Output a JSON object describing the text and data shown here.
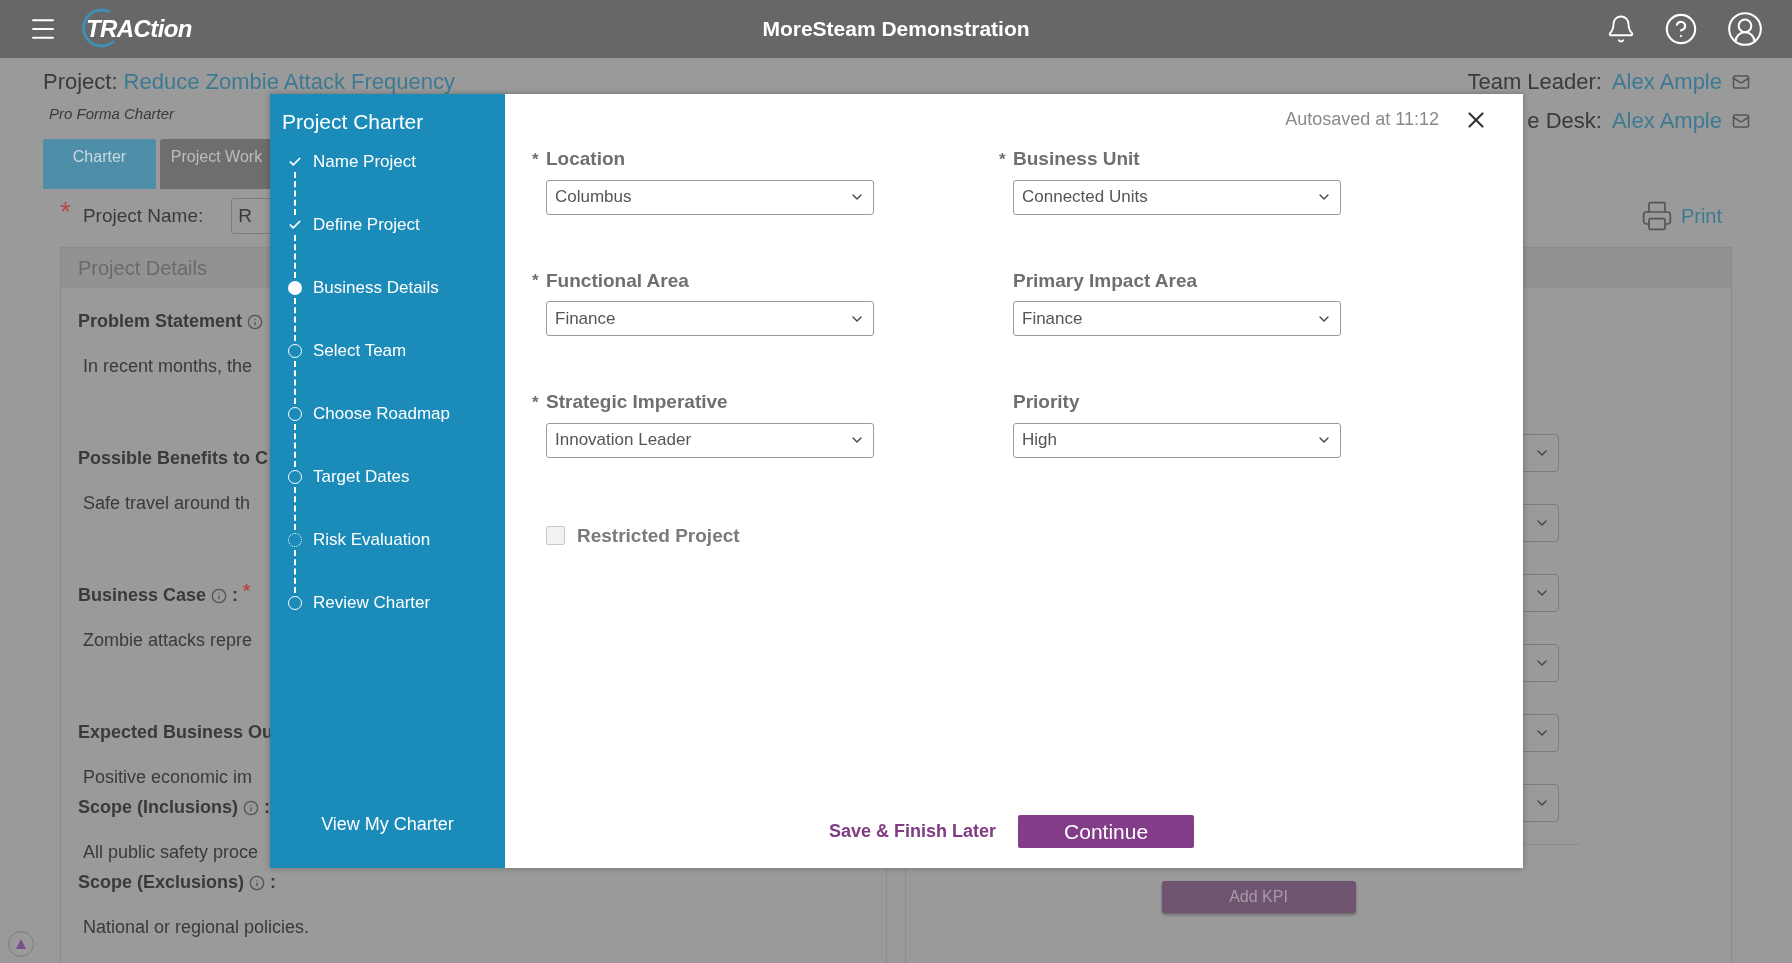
{
  "top_bar": {
    "logo": "TRACtion",
    "title": "MoreSteam Demonstration"
  },
  "project": {
    "label": "Project:",
    "name": "Reduce Zombie Attack Frequency",
    "subtitle": "Pro Forma Charter"
  },
  "people": [
    {
      "label": "Team Leader:",
      "name": "Alex Ample"
    },
    {
      "label": "e Desk:",
      "name": "Alex Ample"
    }
  ],
  "tabs": [
    {
      "label": "Charter",
      "selected": true
    },
    {
      "label": "Project Work",
      "selected": false
    }
  ],
  "project_name": {
    "required_mark": "*",
    "label": "Project Name:",
    "value": "R"
  },
  "print": "Print",
  "details": {
    "title": "Project Details",
    "sections": [
      {
        "title": "Problem Statement",
        "info": true,
        "text": "In recent months, the",
        "kind": "long"
      },
      {
        "title": "Possible Benefits to C",
        "info": false,
        "text": "Safe travel around th",
        "kind": "long"
      },
      {
        "title": "Business Case",
        "info": true,
        "colon": ":",
        "required_mark": "*",
        "text": "Zombie attacks repre",
        "kind": "long"
      },
      {
        "title": "Expected Business Ou",
        "info": false,
        "text": "Positive economic im",
        "kind": "short"
      },
      {
        "title": "Scope (Inclusions)",
        "info": true,
        "colon": ":",
        "text": "All public safety proce",
        "kind": "short"
      },
      {
        "title": "Scope (Exclusions)",
        "info": true,
        "colon": ":",
        "text": "National or regional policies.",
        "kind": "short"
      }
    ]
  },
  "kpi_panel": {
    "selects": [
      {
        "kind": "select"
      },
      {
        "kind": "select"
      },
      {
        "kind": "select"
      },
      {
        "kind": "select"
      },
      {
        "kind": "select"
      },
      {
        "kind": "select"
      }
    ],
    "button": "Add KPI"
  },
  "modal": {
    "title": "Project Charter",
    "steps": [
      {
        "label": "Name Project",
        "kind": "done"
      },
      {
        "label": "Define Project",
        "kind": "done"
      },
      {
        "label": "Business Details",
        "kind": "current"
      },
      {
        "label": "Select Team",
        "kind": "todo"
      },
      {
        "label": "Choose Roadmap",
        "kind": "todo"
      },
      {
        "label": "Target Dates",
        "kind": "todo"
      },
      {
        "label": "Risk Evaluation",
        "kind": "partial"
      },
      {
        "label": "Review Charter",
        "kind": "todo"
      }
    ],
    "view_link": "View My Charter",
    "autosave": "Autosaved at 11:12",
    "fields": [
      {
        "required_mark": "*",
        "label": "Location",
        "value": "Columbus"
      },
      {
        "required_mark": "*",
        "label": "Business Unit",
        "value": "Connected Units"
      },
      {
        "required_mark": "*",
        "label": "Functional Area",
        "value": "Finance"
      },
      {
        "label": "Primary Impact Area",
        "value": "Finance"
      },
      {
        "required_mark": "*",
        "label": "Strategic Imperative",
        "value": "Innovation Leader"
      },
      {
        "label": "Priority",
        "value": "High"
      }
    ],
    "restricted": {
      "label": "Restricted Project",
      "checked": false
    },
    "save_later": "Save & Finish Later",
    "continue": "Continue"
  }
}
